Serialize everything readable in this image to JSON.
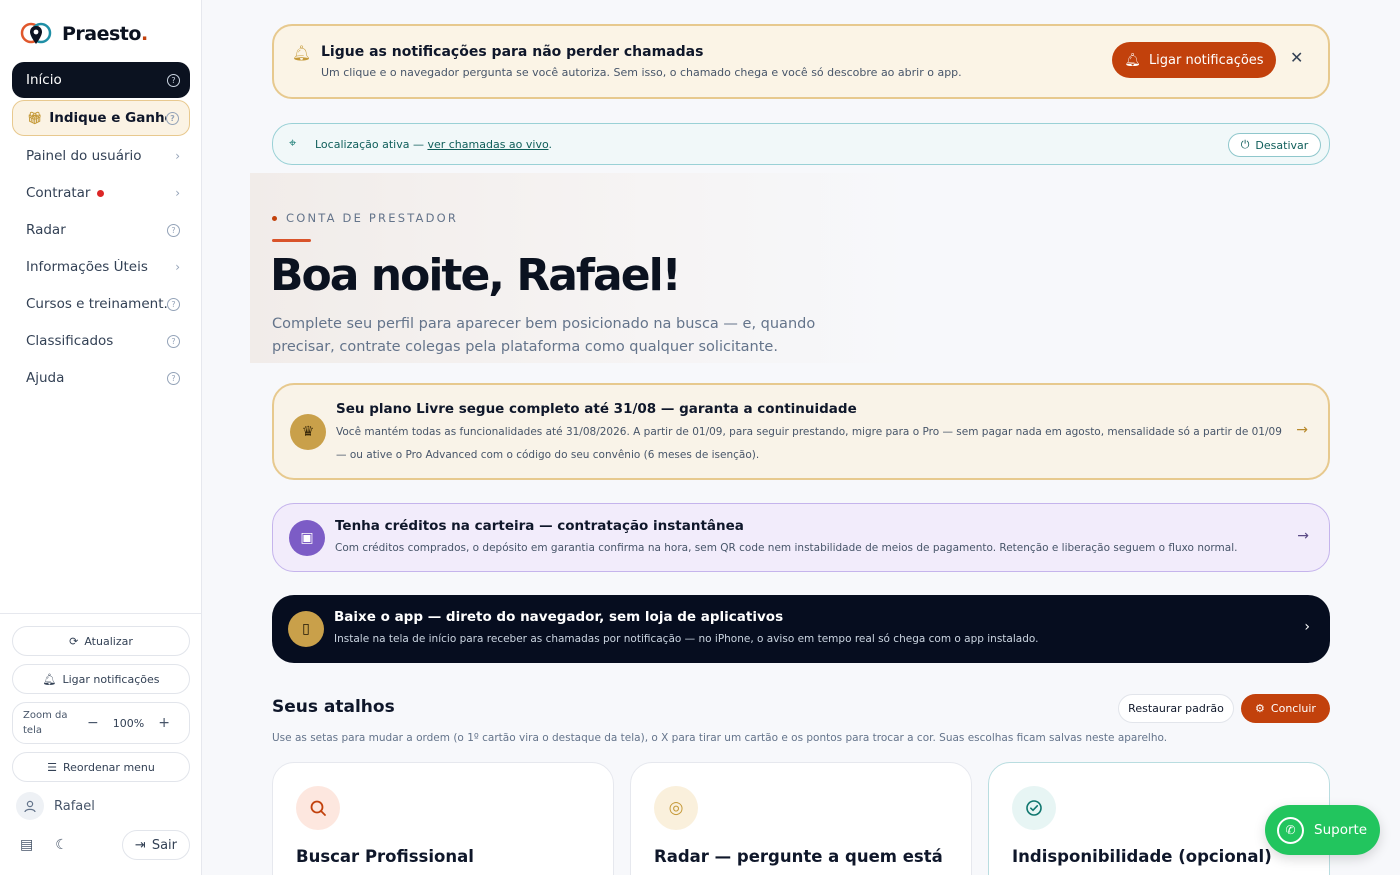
{
  "brand": {
    "name": "Praesto",
    "suffix": "."
  },
  "sidebar": {
    "items": [
      {
        "label": "Início"
      },
      {
        "label": "Indique e Ganhe"
      },
      {
        "label": "Painel do usuário"
      },
      {
        "label": "Contratar"
      },
      {
        "label": "Radar"
      },
      {
        "label": "Informações Úteis"
      },
      {
        "label": "Cursos e treinament..."
      },
      {
        "label": "Classificados"
      },
      {
        "label": "Ajuda"
      }
    ],
    "refresh_label": "Atualizar",
    "notify_label": "Ligar notificações",
    "zoom_label": "Zoom da tela",
    "zoom_value": "100%",
    "zoom_minus": "−",
    "zoom_plus": "+",
    "reorder_label": "Reordenar menu",
    "user_name": "Rafael",
    "logout_label": "Sair"
  },
  "notification_banner": {
    "title": "Ligue as notificações para não perder chamadas",
    "subtitle": "Um clique e o navegador pergunta se você autoriza. Sem isso, o chamado chega e você só descobre ao abrir o app.",
    "cta": "Ligar notificações",
    "close": "✕"
  },
  "location_bar": {
    "prefix": "Localização ativa — ",
    "link": "ver chamadas ao vivo",
    "suffix": ".",
    "button": "Desativar"
  },
  "hero": {
    "eyebrow": "CONTA DE PRESTADOR",
    "greeting": "Boa noite, Rafael!",
    "subtitle": "Complete seu perfil para aparecer bem posicionado na busca — e, quando precisar, contrate colegas pela plataforma como qualquer solicitante."
  },
  "cards": [
    {
      "title": "Seu plano Livre segue completo até 31/08 — garanta a continuidade",
      "text": "Você mantém todas as funcionalidades até 31/08/2026. A partir de 01/09, para seguir prestando, migre para o Pro — sem pagar nada em agosto, mensalidade só a partir de 01/09 — ou ative o Pro Advanced com o código do seu convênio (6 meses de isenção).",
      "icon": "crown-icon"
    },
    {
      "title": "Tenha créditos na carteira — contratação instantânea",
      "text": "Com créditos comprados, o depósito em garantia confirma na hora, sem QR code nem instabilidade de meios de pagamento. Retenção e liberação seguem o fluxo normal.",
      "icon": "wallet-icon"
    },
    {
      "title": "Baixe o app — direto do navegador, sem loja de aplicativos",
      "text": "Instale na tela de início para receber as chamadas por notificação — no iPhone, o aviso em tempo real só chega com o app instalado.",
      "icon": "phone-icon"
    }
  ],
  "shortcuts": {
    "title": "Seus atalhos",
    "restore": "Restaurar padrão",
    "done": "Concluir",
    "hint": "Use as setas para mudar a ordem (o 1º cartão vira o destaque da tela), o X para tirar um cartão e os pontos para trocar a cor. Suas escolhas ficam salvas neste aparelho.",
    "items": [
      {
        "title": "Buscar Profissional",
        "icon": "search-icon"
      },
      {
        "title": "Radar — pergunte a quem está",
        "icon": "radar-icon"
      },
      {
        "title": "Indisponibilidade (opcional)",
        "icon": "check-circle-icon"
      }
    ]
  },
  "support": {
    "label": "Suporte"
  },
  "colors": {
    "accent": "#c2410c",
    "dark": "#0b1220",
    "gold": "#c9a04a",
    "purple": "#7c5cc6",
    "teal": "#0f766e",
    "whatsapp": "#22c55e"
  }
}
